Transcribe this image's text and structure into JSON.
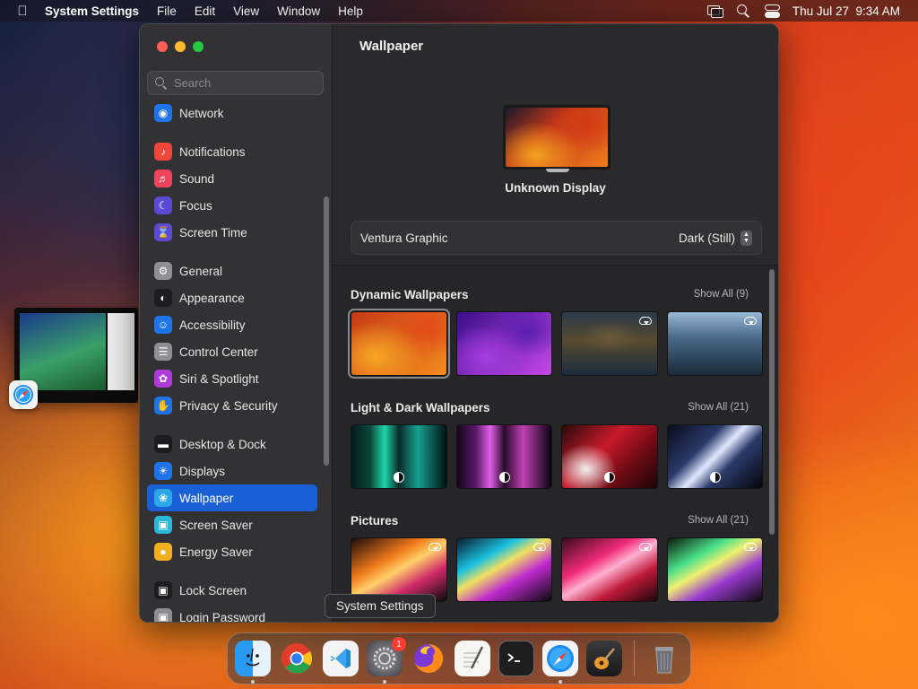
{
  "menubar": {
    "apple_icon": "apple-logo-icon",
    "app_name": "System Settings",
    "menus": [
      "File",
      "Edit",
      "View",
      "Window",
      "Help"
    ],
    "status_icons": [
      "screen-mirroring-icon",
      "spotlight-search-icon",
      "control-center-icon"
    ],
    "clock": "Thu Jul 27  9:34 AM"
  },
  "window": {
    "search_placeholder": "Search",
    "sidebar": {
      "groups": [
        [
          {
            "label": "Network",
            "icon": "globe-icon",
            "color": "#1f74e8"
          }
        ],
        [
          {
            "label": "Notifications",
            "icon": "bell-icon",
            "color": "#f0453a"
          },
          {
            "label": "Sound",
            "icon": "speaker-icon",
            "color": "#f0445a"
          },
          {
            "label": "Focus",
            "icon": "moon-icon",
            "color": "#5a4ad6"
          },
          {
            "label": "Screen Time",
            "icon": "hourglass-icon",
            "color": "#5a4ad6"
          }
        ],
        [
          {
            "label": "General",
            "icon": "gear-icon",
            "color": "#8e8e93"
          },
          {
            "label": "Appearance",
            "icon": "appearance-icon",
            "color": "#1c1c1e"
          },
          {
            "label": "Accessibility",
            "icon": "accessibility-icon",
            "color": "#1f74e8"
          },
          {
            "label": "Control Center",
            "icon": "control-center-icon",
            "color": "#8e8e93"
          },
          {
            "label": "Siri & Spotlight",
            "icon": "siri-icon",
            "color": "#b03ad8"
          },
          {
            "label": "Privacy & Security",
            "icon": "hand-icon",
            "color": "#1f74e8"
          }
        ],
        [
          {
            "label": "Desktop & Dock",
            "icon": "dock-icon",
            "color": "#1c1c1e"
          },
          {
            "label": "Displays",
            "icon": "sun-icon",
            "color": "#1f74e8"
          },
          {
            "label": "Wallpaper",
            "icon": "wallpaper-icon",
            "color": "#2aa8e8",
            "selected": true
          },
          {
            "label": "Screen Saver",
            "icon": "screen-saver-icon",
            "color": "#2ab8d8"
          },
          {
            "label": "Energy Saver",
            "icon": "lightbulb-icon",
            "color": "#f0b020"
          }
        ],
        [
          {
            "label": "Lock Screen",
            "icon": "lock-icon",
            "color": "#1c1c1e"
          },
          {
            "label": "Login Password",
            "icon": "padlock-icon",
            "color": "#8e8e93"
          }
        ]
      ]
    },
    "content": {
      "title": "Wallpaper",
      "display_name": "Unknown Display",
      "wallpaper_name": "Ventura Graphic",
      "appearance_value": "Dark (Still)",
      "sections": [
        {
          "title": "Dynamic Wallpapers",
          "show_all": "Show All (9)",
          "thumbs": [
            {
              "name": "ventura",
              "class": "w-ventura",
              "selected": true,
              "cloud": false,
              "mode": false
            },
            {
              "name": "monterey",
              "class": "w-monterey",
              "selected": false,
              "cloud": false,
              "mode": false
            },
            {
              "name": "big-sur-coast",
              "class": "w-bigsur1",
              "selected": false,
              "cloud": true,
              "mode": false
            },
            {
              "name": "catalina",
              "class": "w-bigsur2",
              "selected": false,
              "cloud": true,
              "mode": false
            }
          ]
        },
        {
          "title": "Light & Dark Wallpapers",
          "show_all": "Show All (21)",
          "thumbs": [
            {
              "name": "macbook-pro-green",
              "class": "w-ld1",
              "selected": false,
              "cloud": false,
              "mode": true
            },
            {
              "name": "macbook-pro-purple",
              "class": "w-ld2",
              "selected": false,
              "cloud": false,
              "mode": true
            },
            {
              "name": "imac-red",
              "class": "w-ld3",
              "selected": false,
              "cloud": false,
              "mode": true
            },
            {
              "name": "imac-blue",
              "class": "w-ld4",
              "selected": false,
              "cloud": false,
              "mode": true
            }
          ]
        },
        {
          "title": "Pictures",
          "show_all": "Show All (21)",
          "thumbs": [
            {
              "name": "swirl-orange",
              "class": "w-p1",
              "selected": false,
              "cloud": true,
              "mode": false
            },
            {
              "name": "swirl-cyan",
              "class": "w-p2",
              "selected": false,
              "cloud": true,
              "mode": false
            },
            {
              "name": "swirl-pink",
              "class": "w-p3",
              "selected": false,
              "cloud": true,
              "mode": false
            },
            {
              "name": "swirl-green",
              "class": "w-p4",
              "selected": false,
              "cloud": true,
              "mode": false
            }
          ]
        }
      ]
    }
  },
  "tooltip": "System Settings",
  "dock": {
    "apps": [
      {
        "name": "finder",
        "icon": "finder-icon",
        "running": true
      },
      {
        "name": "chrome",
        "icon": "chrome-icon",
        "running": false
      },
      {
        "name": "vscode",
        "icon": "vscode-icon",
        "running": false
      },
      {
        "name": "system-settings",
        "icon": "system-settings-icon",
        "running": true,
        "badge": "1"
      },
      {
        "name": "firefox",
        "icon": "firefox-icon",
        "running": false
      },
      {
        "name": "textedit",
        "icon": "textedit-icon",
        "running": false
      },
      {
        "name": "terminal",
        "icon": "terminal-icon",
        "running": false
      },
      {
        "name": "safari",
        "icon": "safari-icon",
        "running": true
      },
      {
        "name": "garageband",
        "icon": "garageband-icon",
        "running": false
      }
    ],
    "trash": "trash-icon"
  }
}
